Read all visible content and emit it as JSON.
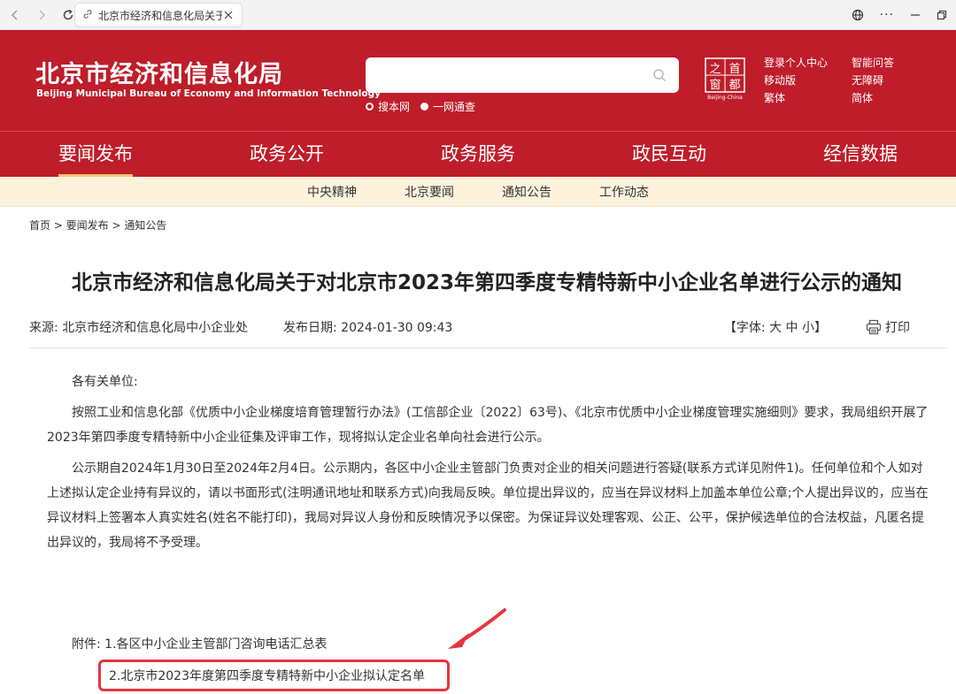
{
  "browser": {
    "tab_title": "北京市经济和信息化局关于对",
    "menu_glyph": "···"
  },
  "header": {
    "logo_cn": "北京市经济和信息化局",
    "logo_en": "Beijing Municipal Bureau of Economy and Information Technology",
    "search_placeholder": "",
    "search_options": [
      {
        "label": "搜本网",
        "selected": false
      },
      {
        "label": "一网通查",
        "selected": true
      }
    ],
    "capital_logo_chars": [
      "之",
      "首",
      "窗",
      "都"
    ],
    "capital_logo_en": "Beijing-China",
    "links": [
      "登录个人中心",
      "智能问答",
      "移动版",
      "无障碍",
      "繁体",
      "简体"
    ]
  },
  "mainnav": [
    {
      "label": "要闻发布",
      "active": true
    },
    {
      "label": "政务公开",
      "active": false
    },
    {
      "label": "政务服务",
      "active": false
    },
    {
      "label": "政民互动",
      "active": false
    },
    {
      "label": "经信数据",
      "active": false
    }
  ],
  "subnav": [
    "中央精神",
    "北京要闻",
    "通知公告",
    "工作动态"
  ],
  "breadcrumb": "首页 > 要闻发布 > 通知公告",
  "article": {
    "title": "北京市经济和信息化局关于对北京市2023年第四季度专精特新中小企业名单进行公示的通知",
    "source": "来源:  北京市经济和信息化局中小企业处",
    "date": "发布日期:  2024-01-30 09:43",
    "fontsize": "【字体:  大 中 小】",
    "print": "打印",
    "salutation": "各有关单位:",
    "paragraphs": [
      "按照工业和信息化部《优质中小企业梯度培育管理暂行办法》(工信部企业〔2022〕63号)、《北京市优质中小企业梯度管理实施细则》要求，我局组织开展了2023年第四季度专精特新中小企业征集及评审工作，现将拟认定企业名单向社会进行公示。",
      "公示期自2024年1月30日至2024年2月4日。公示期内，各区中小企业主管部门负责对企业的相关问题进行答疑(联系方式详见附件1)。任何单位和个人如对上述拟认定企业持有异议的，请以书面形式(注明通讯地址和联系方式)向我局反映。单位提出异议的，应当在异议材料上加盖本单位公章;个人提出异议的，应当在异议材料上签署本人真实姓名(姓名不能打印)，我局对异议人身份和反映情况予以保密。为保证异议处理客观、公正、公平，保护候选单位的合法权益，凡匿名提出异议的，我局将不予受理。"
    ],
    "attachment_1": "附件:  1.各区中小企业主管部门咨询电话汇总表",
    "attachment_2": "2.北京市2023年度第四季度专精特新中小企业拟认定名单"
  },
  "colors": {
    "brand_red": "#bf1d2a",
    "subnav_bg": "#fdf3dd",
    "highlight": "#e8343f"
  }
}
